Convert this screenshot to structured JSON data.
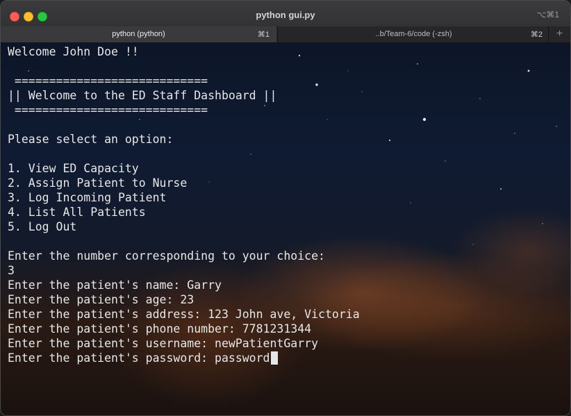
{
  "window": {
    "title": "python gui.py",
    "shortcut": "⌥⌘1"
  },
  "tabs": [
    {
      "label": "python (python)",
      "shortcut": "⌘1",
      "active": true
    },
    {
      "label": "..b/Team-6/code (-zsh)",
      "shortcut": "⌘2",
      "active": false
    }
  ],
  "new_tab_symbol": "+",
  "terminal": {
    "lines": [
      "Welcome John Doe !!",
      "",
      " ============================",
      "|| Welcome to the ED Staff Dashboard ||",
      " ============================",
      "",
      "Please select an option:",
      "",
      "1. View ED Capacity",
      "2. Assign Patient to Nurse",
      "3. Log Incoming Patient",
      "4. List All Patients",
      "5. Log Out",
      "",
      "Enter the number corresponding to your choice:",
      "3",
      "Enter the patient's name: Garry",
      "Enter the patient's age: 23",
      "Enter the patient's address: 123 John ave, Victoria",
      "Enter the patient's phone number: 7781231344",
      "Enter the patient's username: newPatientGarry",
      "Enter the patient's password: password"
    ]
  },
  "colors": {
    "close": "#ff5f57",
    "minimize": "#febc2e",
    "zoom": "#28c840",
    "terminal_text": "#e8e8e8"
  }
}
